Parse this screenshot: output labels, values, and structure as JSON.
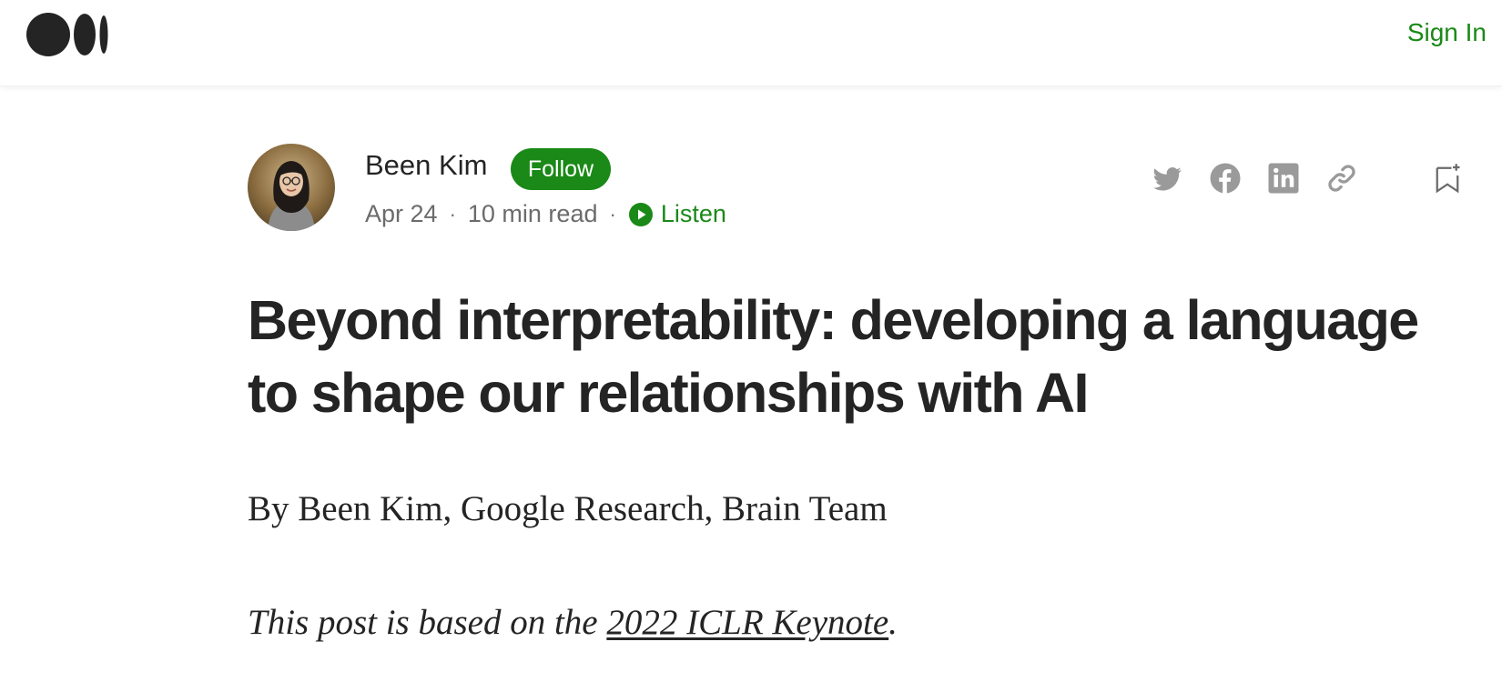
{
  "header": {
    "logo_icon": "medium-logo-icon",
    "sign_in_label": "Sign In",
    "accent_color": "#1a8917"
  },
  "author": {
    "name": "Been Kim",
    "follow_label": "Follow",
    "avatar_icon": "author-avatar"
  },
  "meta": {
    "date": "Apr 24",
    "separator": "·",
    "read_time": "10 min read",
    "listen_label": "Listen",
    "listen_icon": "play-circle-icon"
  },
  "share": {
    "icons": [
      "twitter-icon",
      "facebook-icon",
      "linkedin-icon",
      "link-icon"
    ],
    "bookmark_icon": "bookmark-add-icon"
  },
  "article": {
    "title": "Beyond interpretability: developing a language to shape our relationships with AI",
    "byline": "By Been Kim, Google Research, Brain Team",
    "intro_prefix": "This post is based on the ",
    "intro_link": "2022 ICLR Keynote",
    "intro_suffix": "."
  }
}
